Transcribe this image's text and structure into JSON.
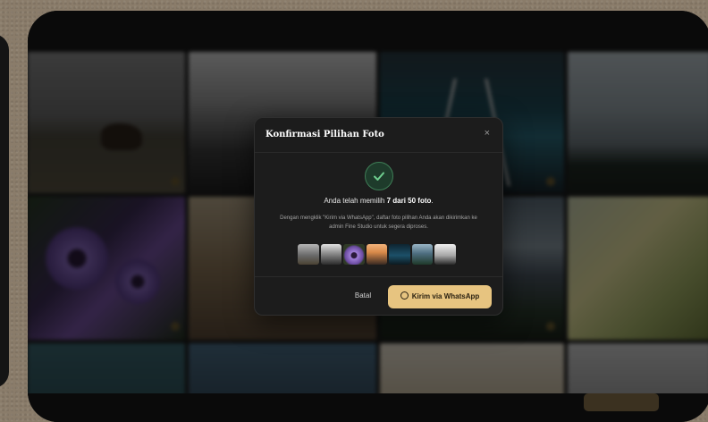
{
  "modal": {
    "title": "Konfirmasi Pilihan Foto",
    "close_icon": "×",
    "headline_prefix": "Anda telah memilih ",
    "headline_count": "7 dari 50 foto",
    "headline_suffix": ".",
    "description": "Dengan mengklik \"Kirim via WhatsApp\", daftar foto pilihan Anda akan dikirimkan ke admin Fine Studio untuk segera diproses.",
    "cancel_label": "Batal",
    "send_label": "Kirim via WhatsApp",
    "thumbnail_count": 7,
    "accent_color": "#e7c480",
    "success_color": "#3f7e57"
  },
  "icons": [
    "check-icon",
    "close-icon",
    "whatsapp-icon"
  ]
}
